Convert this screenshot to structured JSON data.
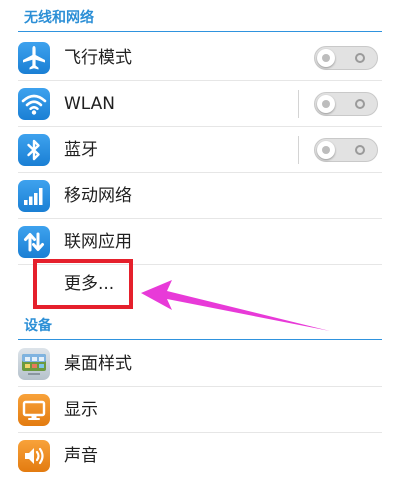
{
  "sections": {
    "wireless": {
      "title": "无线和网络"
    },
    "device": {
      "title": "设备"
    }
  },
  "rows": {
    "airplane": {
      "label": "飞行模式",
      "icon": "airplane-icon",
      "toggle": "off"
    },
    "wlan": {
      "label": "WLAN",
      "icon": "wifi-icon",
      "toggle": "off"
    },
    "bluetooth": {
      "label": "蓝牙",
      "icon": "bluetooth-icon",
      "toggle": "off"
    },
    "mobile_network": {
      "label": "移动网络",
      "icon": "signal-bars-icon"
    },
    "network_apps": {
      "label": "联网应用",
      "icon": "data-transfer-icon"
    },
    "more": {
      "label": "更多..."
    },
    "desktop_style": {
      "label": "桌面样式",
      "icon": "desktop-style-icon"
    },
    "display": {
      "label": "显示",
      "icon": "monitor-icon"
    },
    "sound": {
      "label": "声音",
      "icon": "speaker-icon"
    }
  },
  "annotation": {
    "highlight_color": "#e5202c",
    "arrow_color": "#e83ad8"
  },
  "colors": {
    "accent": "#2c8fd6",
    "icon_blue": "#2a8fe0",
    "icon_orange": "#f08c20"
  }
}
